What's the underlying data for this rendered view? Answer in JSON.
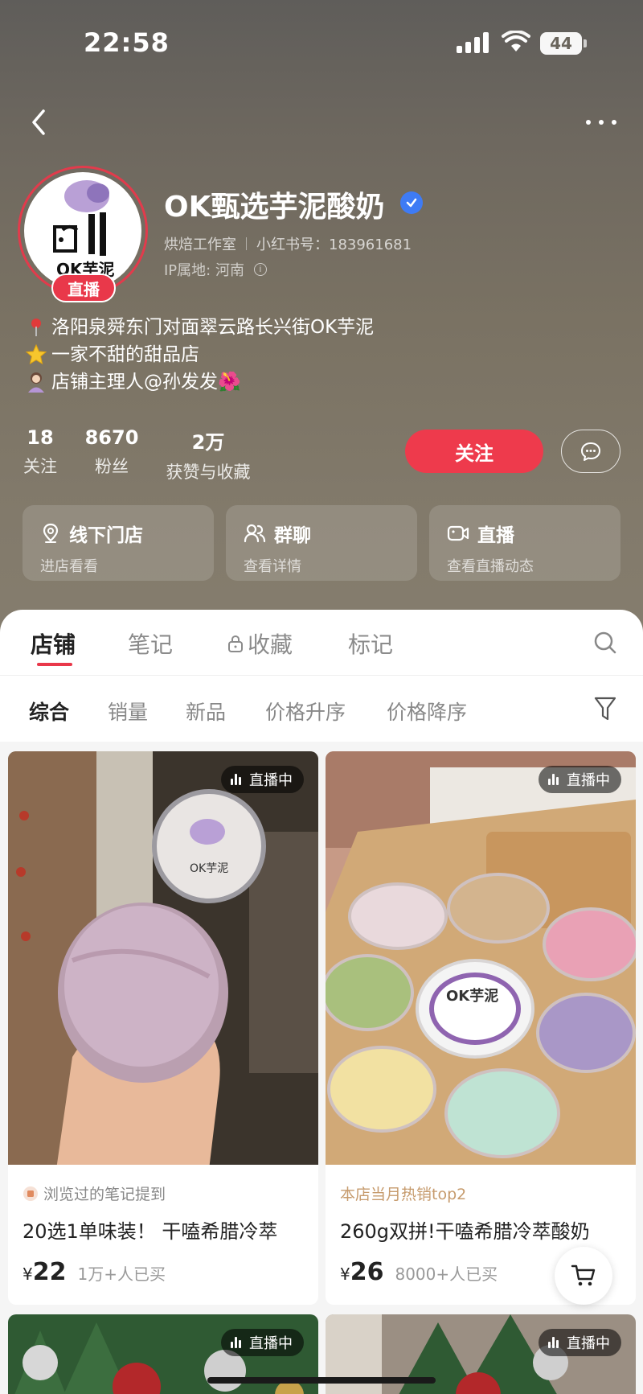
{
  "status": {
    "time": "22:58",
    "battery": "44"
  },
  "profile": {
    "name": "OK甄选芋泥酸奶",
    "category": "烘焙工作室",
    "xhs_id": "小红书号：183961681",
    "ip": "IP属地: 河南",
    "live_badge": "直播",
    "bio": [
      {
        "icon": "pin-icon",
        "text": "洛阳泉舜东门对面翠云路长兴街OK芋泥"
      },
      {
        "icon": "star-icon",
        "text": "一家不甜的甜品店"
      },
      {
        "icon": "person-icon",
        "text": "店铺主理人@孙发发🌺"
      }
    ]
  },
  "stats": [
    {
      "num": "18",
      "label": "关注"
    },
    {
      "num": "8670",
      "label": "粉丝"
    },
    {
      "num": "2万",
      "label": "获赞与收藏"
    }
  ],
  "actions": {
    "follow": "关注"
  },
  "features": [
    {
      "title": "线下门店",
      "desc": "进店看看"
    },
    {
      "title": "群聊",
      "desc": "查看详情"
    },
    {
      "title": "直播",
      "desc": "查看直播动态"
    }
  ],
  "tabs": [
    "店铺",
    "笔记",
    "收藏",
    "标记"
  ],
  "sorts": [
    "综合",
    "销量",
    "新品",
    "价格升序",
    "价格降序"
  ],
  "products": [
    {
      "live": "直播中",
      "tagline": "浏览过的笔记提到",
      "title": "20选1单味装！ 干嗑希腊冷萃",
      "currency": "¥",
      "price": "22",
      "sold": "1万+人已买"
    },
    {
      "live": "直播中",
      "tagline": "本店当月热销top2",
      "title": "260g双拼!干嗑希腊冷萃酸奶",
      "currency": "¥",
      "price": "26",
      "sold": "8000+人已买"
    },
    {
      "live": "直播中"
    },
    {
      "live": "直播中"
    }
  ],
  "colors": {
    "accent": "#ee3a4c",
    "verified": "#3e7bf5",
    "hot": "#c69b6d"
  }
}
